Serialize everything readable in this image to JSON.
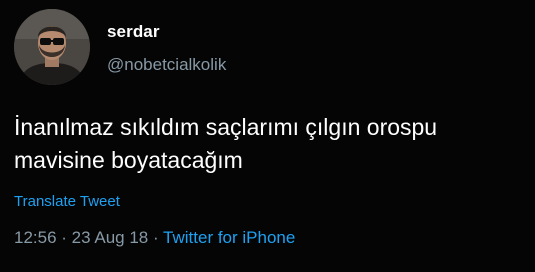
{
  "user": {
    "display_name": "serdar",
    "handle": "@nobetcialkolik"
  },
  "tweet": {
    "text": "İnanılmaz sıkıldım saçlarımı çılgın orospu\nmavisine boyatacağım",
    "translate_label": "Translate Tweet"
  },
  "meta": {
    "time": "12:56",
    "separator": " · ",
    "date": "23 Aug 18",
    "source": "Twitter for iPhone"
  },
  "colors": {
    "background": "#050505",
    "text": "#ffffff",
    "secondary": "#8899a6",
    "link": "#1da1f2"
  }
}
